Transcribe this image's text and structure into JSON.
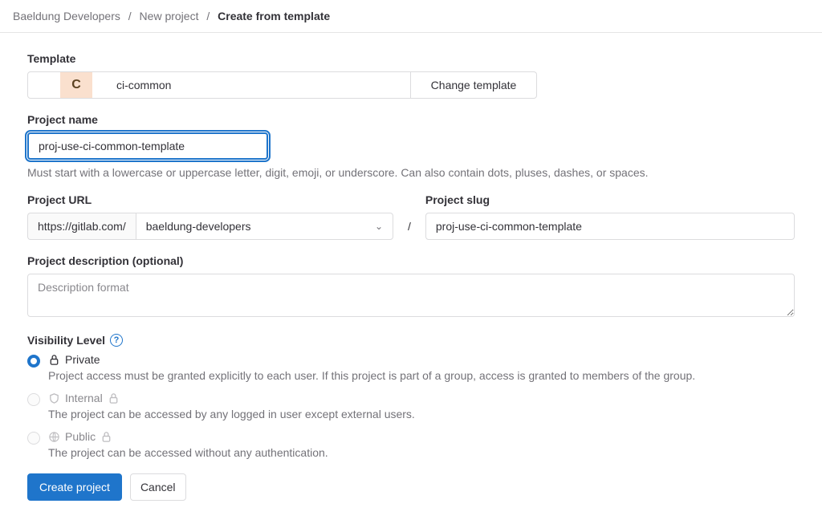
{
  "breadcrumb": {
    "group": "Baeldung Developers",
    "parent": "New project",
    "current": "Create from template"
  },
  "template": {
    "label": "Template",
    "icon_letter": "C",
    "name": "ci-common",
    "change_btn": "Change template"
  },
  "project_name": {
    "label": "Project name",
    "value": "proj-use-ci-common-template",
    "help": "Must start with a lowercase or uppercase letter, digit, emoji, or underscore. Can also contain dots, pluses, dashes, or spaces."
  },
  "project_url": {
    "label": "Project URL",
    "base": "https://gitlab.com/",
    "namespace": "baeldung-developers"
  },
  "project_slug": {
    "label": "Project slug",
    "value": "proj-use-ci-common-template"
  },
  "description": {
    "label": "Project description (optional)",
    "placeholder": "Description format"
  },
  "visibility": {
    "label": "Visibility Level",
    "options": [
      {
        "title": "Private",
        "desc": "Project access must be granted explicitly to each user. If this project is part of a group, access is granted to members of the group.",
        "selected": true,
        "disabled": false
      },
      {
        "title": "Internal",
        "desc": "The project can be accessed by any logged in user except external users.",
        "selected": false,
        "disabled": true
      },
      {
        "title": "Public",
        "desc": "The project can be accessed without any authentication.",
        "selected": false,
        "disabled": true
      }
    ]
  },
  "actions": {
    "submit": "Create project",
    "cancel": "Cancel"
  }
}
